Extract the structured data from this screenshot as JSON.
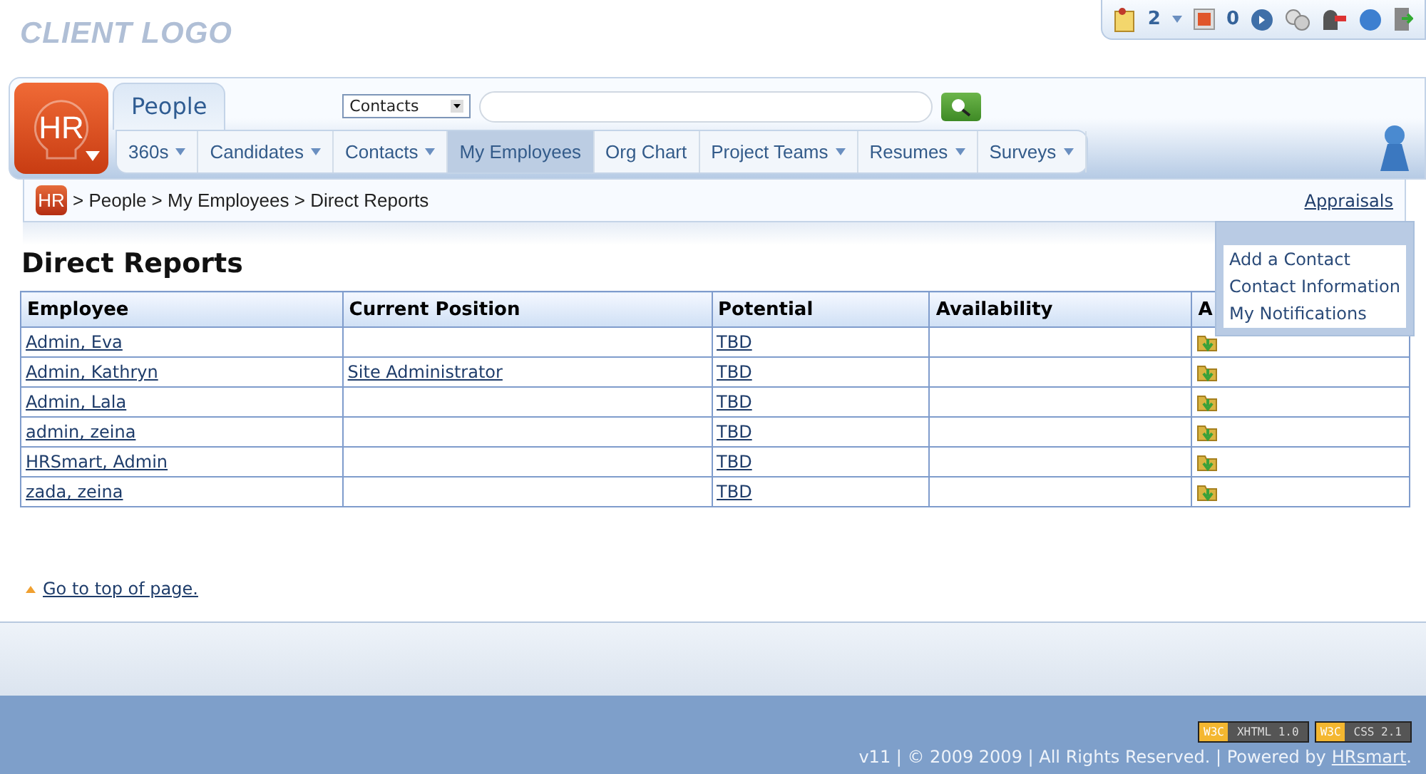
{
  "logo": {
    "text": "CLIENT LOGO"
  },
  "toolbar": {
    "notes_count": "2",
    "messages_count": "0"
  },
  "header": {
    "logo_text": "HR",
    "module_tab": "People",
    "search_scope": "Contacts"
  },
  "nav": [
    {
      "label": "360s",
      "dropdown": true,
      "selected": false
    },
    {
      "label": "Candidates",
      "dropdown": true,
      "selected": false
    },
    {
      "label": "Contacts",
      "dropdown": true,
      "selected": false
    },
    {
      "label": "My Employees",
      "dropdown": false,
      "selected": true
    },
    {
      "label": "Org Chart",
      "dropdown": false,
      "selected": false
    },
    {
      "label": "Project Teams",
      "dropdown": true,
      "selected": false
    },
    {
      "label": "Resumes",
      "dropdown": true,
      "selected": false
    },
    {
      "label": "Surveys",
      "dropdown": true,
      "selected": false
    }
  ],
  "breadcrumb": {
    "badge": "HR",
    "path": "> People > My Employees > Direct Reports",
    "link": "Appraisals"
  },
  "page_title": "Direct Reports",
  "menu": [
    "Add a Contact",
    "Contact Information",
    "My Notifications"
  ],
  "table": {
    "columns": [
      "Employee",
      "Current Position",
      "Potential",
      "Availability",
      "A"
    ],
    "rows": [
      {
        "employee": "Admin, Eva",
        "potential": "TBD"
      },
      {
        "employee": "Admin, Kathryn",
        "position": "Site Administrator",
        "potential": "TBD"
      },
      {
        "employee": "Admin, Lala",
        "potential": "TBD"
      },
      {
        "employee": "admin, zeina",
        "potential": "TBD"
      },
      {
        "employee": "HRSmart, Admin",
        "potential": "TBD"
      },
      {
        "employee": "zada, zeina",
        "potential": "TBD"
      }
    ]
  },
  "top_link": "Go to top of page.",
  "footer": {
    "badges": [
      {
        "left": "W3C",
        "right": "XHTML 1.0"
      },
      {
        "left": "W3C",
        "right": "CSS 2.1"
      }
    ],
    "text": "v11 | © 2009 2009 | All Rights Reserved. | Powered by",
    "link": "HRsmart",
    "end": "."
  }
}
